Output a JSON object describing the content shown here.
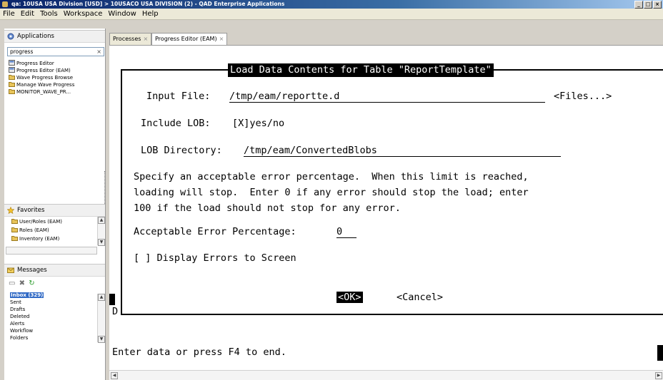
{
  "window": {
    "title": "qa: 10USA USA Division [USD] > 10USACO USA DIVISION (2) - QAD Enterprise Applications",
    "controls": [
      "_",
      "□",
      "×"
    ]
  },
  "menubar": {
    "items": [
      "File",
      "Edit",
      "Tools",
      "Workspace",
      "Window",
      "Help"
    ]
  },
  "sidebar": {
    "applications_label": "Applications",
    "search_value": "progress",
    "search_clear": "×",
    "results": [
      {
        "label": "Progress Editor",
        "icon": "editor-icon"
      },
      {
        "label": "Progress Editor (EAM)",
        "icon": "editor-icon"
      },
      {
        "label": "Wave Progress Browse",
        "icon": "folder-icon"
      },
      {
        "label": "Manage Wave Progress",
        "icon": "folder-icon"
      },
      {
        "label": "MONITOR_WAVE_PR...",
        "icon": "folder-icon"
      }
    ],
    "favorites_label": "Favorites",
    "favorites": [
      {
        "label": "User/Roles (EAM)"
      },
      {
        "label": "Roles (EAM)"
      },
      {
        "label": "Inventory (EAM)"
      }
    ],
    "messages_label": "Messages",
    "message_folders": [
      "Inbox (329)",
      "Sent",
      "Drafts",
      "Deleted",
      "Alerts",
      "Workflow",
      "Folders"
    ]
  },
  "tabs": [
    {
      "label": "Processes",
      "close": "×"
    },
    {
      "label": "Progress Editor (EAM)",
      "close": "×"
    }
  ],
  "dialog": {
    "title": "Load Data Contents for Table \"ReportTemplate\"",
    "input_file_label": "Input File:",
    "input_file_value": "/tmp/eam/reportte.d",
    "files_button": "<Files...>",
    "include_lob_label": "Include LOB:",
    "include_lob_value": "[X]yes/no",
    "lob_dir_label": "LOB Directory:",
    "lob_dir_value": "/tmp/eam/ConvertedBlobs",
    "desc_line1": "Specify an acceptable error percentage.  When this limit is reached,",
    "desc_line2": "loading will stop.  Enter 0 if any error should stop the load; enter",
    "desc_line3": "100 if the load should not stop for any error.",
    "error_pct_label": "Acceptable Error Percentage:",
    "error_pct_value": "0",
    "display_errors": "[ ] Display Errors to Screen",
    "ok_button": "<OK>",
    "cancel_button": "<Cancel>"
  },
  "terminal": {
    "stray_char": "D",
    "status_line": "Enter data or press F4 to end."
  }
}
